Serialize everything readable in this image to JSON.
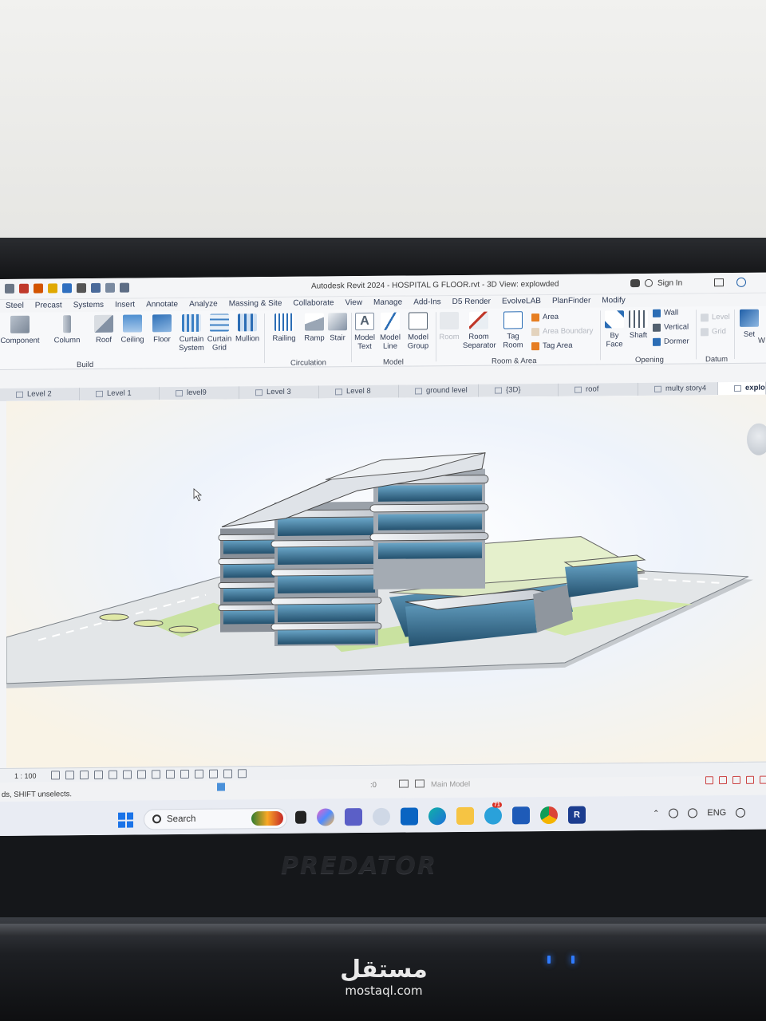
{
  "window": {
    "title": "Autodesk Revit 2024 - HOSPITAL G FLOOR.rvt - 3D View: explowded",
    "sign_in": "Sign In"
  },
  "ribbon_tabs": [
    "Steel",
    "Precast",
    "Systems",
    "Insert",
    "Annotate",
    "Analyze",
    "Massing & Site",
    "Collaborate",
    "View",
    "Manage",
    "Add-Ins",
    "D5 Render",
    "EvolveLAB",
    "PlanFinder",
    "Modify"
  ],
  "tools": {
    "component": "Component",
    "column": "Column",
    "roof": "Roof",
    "ceiling": "Ceiling",
    "floor": "Floor",
    "curtain_system_1": "Curtain",
    "curtain_system_2": "System",
    "curtain_grid_1": "Curtain",
    "curtain_grid_2": "Grid",
    "mullion": "Mullion",
    "railing": "Railing",
    "ramp": "Ramp",
    "stair": "Stair",
    "model_text_1": "Model",
    "model_text_2": "Text",
    "model_line_1": "Model",
    "model_line_2": "Line",
    "model_group_1": "Model",
    "model_group_2": "Group",
    "room": "Room",
    "room_separator_1": "Room",
    "room_separator_2": "Separator",
    "tag_room_1": "Tag",
    "tag_room_2": "Room",
    "area": "Area",
    "area_boundary": "Area Boundary",
    "tag_area": "Tag Area",
    "by_face_1": "By",
    "by_face_2": "Face",
    "shaft": "Shaft",
    "wall": "Wall",
    "vertical": "Vertical",
    "dormer": "Dormer",
    "level": "Level",
    "grid": "Grid",
    "set": "Set",
    "w": "W"
  },
  "panels": {
    "build": "Build",
    "circulation": "Circulation",
    "model": "Model",
    "room_area": "Room & Area",
    "opening": "Opening",
    "datum": "Datum"
  },
  "view_tabs": [
    "Level 2",
    "Level 1",
    "level9",
    "Level 3",
    "Level 8",
    "ground level",
    "{3D}",
    "roof",
    "multy story4",
    "explo"
  ],
  "view_bar": {
    "scale": "1 : 100"
  },
  "status": {
    "message": "ds, SHIFT unselects.",
    "workset_count": ":0",
    "main_model": "Main Model"
  },
  "taskbar": {
    "search": "Search",
    "language": "ENG",
    "badge": "71"
  },
  "device": {
    "brand": "PREDATOR",
    "watermark_ar": "مستقل",
    "watermark_en": "mostaql.com"
  },
  "colors": {
    "ribbon_bg": "#f7f8fa",
    "tab_text": "#2f3b55",
    "glass": "#3f7fa8",
    "site_green": "#c9e2a0",
    "bezel": "#15171a",
    "windows_blue": "#1a73e8"
  }
}
